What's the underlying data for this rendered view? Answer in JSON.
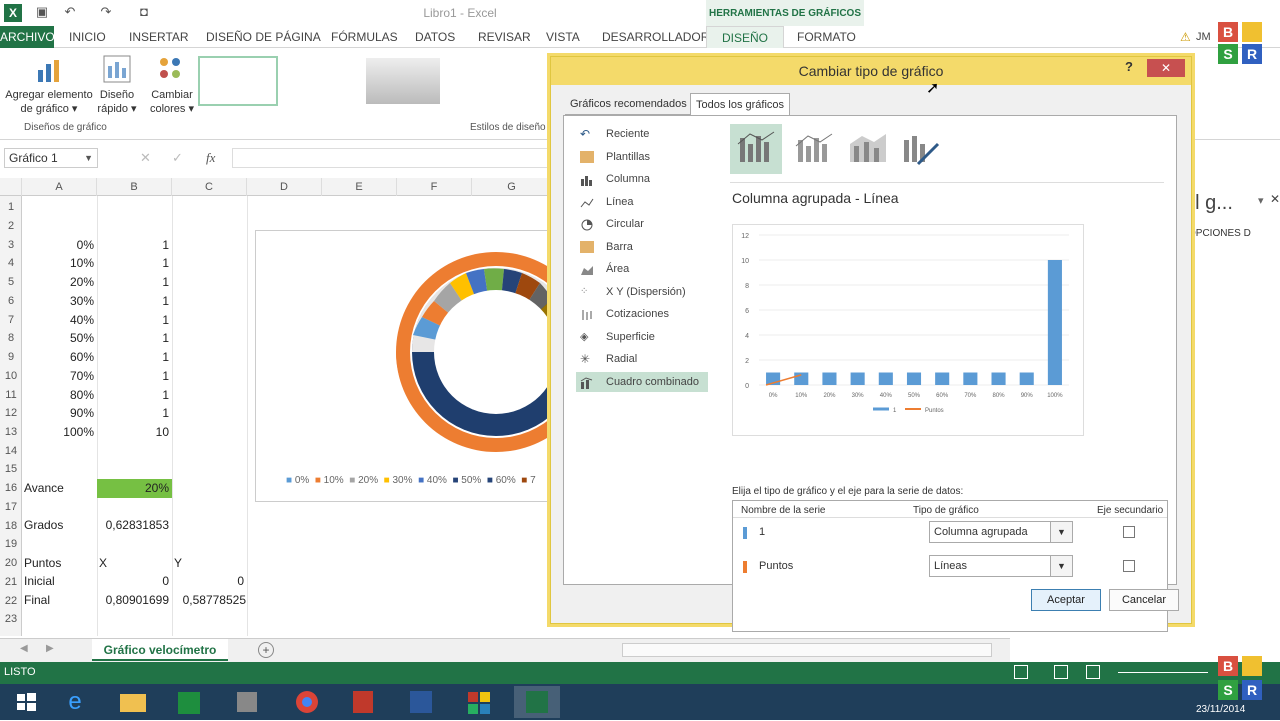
{
  "app": {
    "doc_title": "Libro1 - Excel",
    "chart_tools": "HERRAMIENTAS DE GRÁFICOS",
    "user": "JM"
  },
  "tabs": [
    "ARCHIVO",
    "INICIO",
    "INSERTAR",
    "DISEÑO DE PÁGINA",
    "FÓRMULAS",
    "DATOS",
    "REVISAR",
    "VISTA",
    "DESARROLLADOR",
    "DISEÑO",
    "FORMATO"
  ],
  "ribbon": {
    "add_element": [
      "Agregar elemento",
      "de gráfico ▾"
    ],
    "quick_design": [
      "Diseño",
      "rápido ▾"
    ],
    "change_colors": [
      "Cambiar",
      "colores ▾"
    ],
    "group_designs": "Diseños de gráfico",
    "group_styles": "Estilos de diseño"
  },
  "formula_bar": {
    "name_box": "Gráfico 1",
    "fx": "fx"
  },
  "columns": [
    "A",
    "B",
    "C",
    "D",
    "E",
    "F",
    "G"
  ],
  "rows": [
    "1",
    "2",
    "3",
    "4",
    "5",
    "6",
    "7",
    "8",
    "9",
    "10",
    "11",
    "12",
    "13",
    "14",
    "15",
    "16",
    "17",
    "18",
    "19",
    "20",
    "21",
    "22",
    "23"
  ],
  "cells": {
    "a": [
      "0%",
      "10%",
      "20%",
      "30%",
      "40%",
      "50%",
      "60%",
      "70%",
      "80%",
      "90%",
      "100%"
    ],
    "b": [
      "1",
      "1",
      "1",
      "1",
      "1",
      "1",
      "1",
      "1",
      "1",
      "1",
      "10"
    ],
    "avance_label": "Avance",
    "avance_value": "20%",
    "grados_label": "Grados",
    "grados_value": "0,62831853",
    "puntos_label": "Puntos",
    "x_label": "X",
    "y_label": "Y",
    "inicial_label": "Inicial",
    "inicial_x": "0",
    "inicial_y": "0",
    "final_label": "Final",
    "final_x": "0,80901699",
    "final_y": "0,58778525"
  },
  "donut_legend": [
    "0%",
    "10%",
    "20%",
    "30%",
    "40%",
    "50%",
    "60%",
    "7"
  ],
  "dialog": {
    "title": "Cambiar tipo de gráfico",
    "help": "?",
    "close": "✕",
    "tab_recommended": "Gráficos recomendados",
    "tab_all": "Todos los gráficos",
    "categories": [
      "Reciente",
      "Plantillas",
      "Columna",
      "Línea",
      "Circular",
      "Barra",
      "Área",
      "X Y (Dispersión)",
      "Cotizaciones",
      "Superficie",
      "Radial",
      "Cuadro combinado"
    ],
    "selected_category": "Cuadro combinado",
    "preview_title": "Columna agrupada - Línea",
    "series_prompt": "Elija el tipo de gráfico y el eje para la serie de datos:",
    "col_name": "Nombre de la serie",
    "col_type": "Tipo de gráfico",
    "col_axis": "Eje secundario",
    "series": [
      {
        "name": "1",
        "type": "Columna agrupada",
        "color": "#5b9bd5"
      },
      {
        "name": "Puntos",
        "type": "Líneas",
        "color": "#ed7d31"
      }
    ],
    "ok": "Aceptar",
    "cancel": "Cancelar"
  },
  "chart_data": {
    "type": "bar",
    "categories": [
      "0%",
      "10%",
      "20%",
      "30%",
      "40%",
      "50%",
      "60%",
      "70%",
      "80%",
      "90%",
      "100%"
    ],
    "series": [
      {
        "name": "1",
        "type": "bar",
        "values": [
          1,
          1,
          1,
          1,
          1,
          1,
          1,
          1,
          1,
          1,
          10
        ]
      },
      {
        "name": "Puntos",
        "type": "line",
        "values": [
          0,
          0.81
        ]
      }
    ],
    "yticks": [
      "0",
      "2",
      "4",
      "6",
      "8",
      "10",
      "12"
    ],
    "ylim": [
      0,
      12
    ],
    "legend": [
      "1",
      "Puntos"
    ]
  },
  "right_panel": {
    "title": "el g...",
    "options": "OPCIONES D"
  },
  "sheet_tab": "Gráfico velocímetro",
  "status": {
    "ready": "LISTO"
  },
  "clock": {
    "date": "23/11/2014"
  }
}
